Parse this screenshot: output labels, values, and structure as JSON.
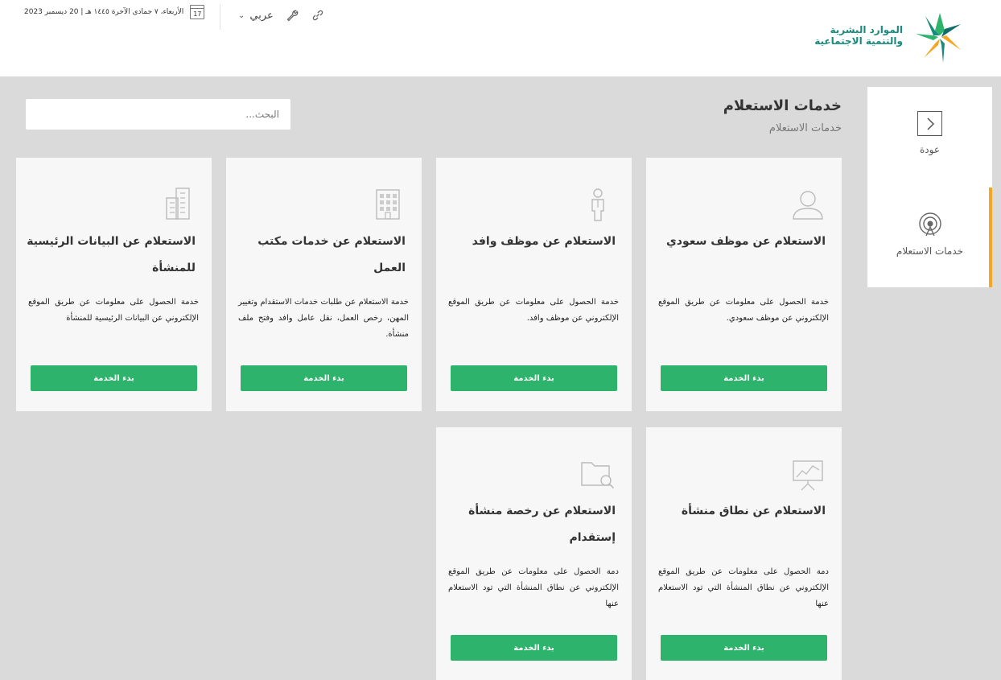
{
  "header": {
    "logo": {
      "line1": "الموارد البشرية",
      "line2": "والتنمية الاجتماعية",
      "colors": [
        "#1a8a7d",
        "#f5a623",
        "#2db36b",
        "#0f6d6a"
      ]
    },
    "language": "عربي",
    "tools": [
      "link-icon",
      "wrench-icon",
      "chevron-down-icon"
    ],
    "date": "الأربعاء، ٧ جمادى الآخرة ١٤٤٥ هـ | 20 ديسمبر 2023",
    "calendar_day": "17"
  },
  "sidebar": {
    "back_label": "عودة",
    "active_label": "خدمات الاستعلام",
    "active_color": "#f5a623"
  },
  "page": {
    "title": "خدمات الاستعلام",
    "breadcrumb": "خدمات الاستعلام",
    "search_placeholder": "البحث..."
  },
  "cards": [
    {
      "icon": "person-icon",
      "title": "الاستعلام عن موظف سعودي",
      "description": "خدمة الحصول على معلومات عن طريق الموقع الإلكتروني عن موظف سعودي.",
      "button": "بدء الخدمة"
    },
    {
      "icon": "worker-icon",
      "title": "الاستعلام عن موظف وافد",
      "description": "خدمة الحصول على معلومات عن طريق الموقع الإلكتروني عن موظف وافد.",
      "button": "بدء الخدمة"
    },
    {
      "icon": "office-building-icon",
      "title": "الاستعلام عن خدمات مكتب العمل",
      "description": "خدمة الاستعلام عن طلبات خدمات الاستقدام وتغيير المهن، رخص العمل، نقل عامل وافد وفتح ملف منشأة.",
      "button": "بدء الخدمة"
    },
    {
      "icon": "buildings-icon",
      "title": "الاستعلام عن البيانات الرئيسية للمنشأة",
      "description": "خدمة الحصول على معلومات عن طريق الموقع الإلكتروني عن البيانات الرئيسية للمنشأة",
      "button": "بدء الخدمة"
    },
    {
      "icon": "presentation-chart-icon",
      "title": "الاستعلام عن نطاق منشأة",
      "description": "دمة الحصول على معلومات عن طريق الموقع الإلكتروني عن نطاق المنشأة التي تود الاستعلام عنها",
      "button": "بدء الخدمة"
    },
    {
      "icon": "folder-search-icon",
      "title": "الاستعلام عن رخصة منشأة إستقدام",
      "description": "دمة الحصول على معلومات عن طريق الموقع الإلكتروني عن نطاق المنشأة التي تود الاستعلام عنها",
      "button": "بدء الخدمة"
    }
  ]
}
